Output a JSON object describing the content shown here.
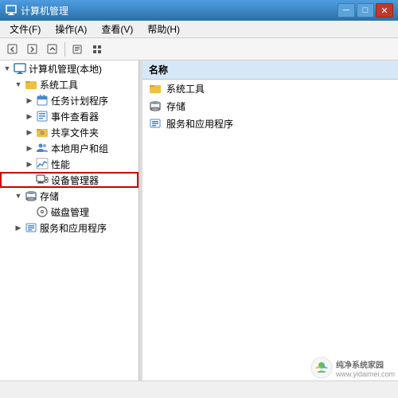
{
  "titleBar": {
    "title": "计算机管理",
    "minimizeLabel": "─",
    "maximizeLabel": "□",
    "closeLabel": "✕"
  },
  "menuBar": {
    "items": [
      {
        "id": "file",
        "label": "文件(F)"
      },
      {
        "id": "action",
        "label": "操作(A)"
      },
      {
        "id": "view",
        "label": "查看(V)"
      },
      {
        "id": "help",
        "label": "帮助(H)"
      }
    ]
  },
  "toolbar": {
    "buttons": [
      "←",
      "→",
      "↑",
      "✎",
      "☰"
    ]
  },
  "leftPanel": {
    "header": "计算机管理(本地)",
    "items": [
      {
        "id": "root",
        "label": "计算机管理(本地)",
        "level": 0,
        "expanded": true,
        "hasChildren": true,
        "icon": "computer"
      },
      {
        "id": "systools",
        "label": "系统工具",
        "level": 1,
        "expanded": true,
        "hasChildren": true,
        "icon": "folder"
      },
      {
        "id": "taskscheduler",
        "label": "任务计划程序",
        "level": 2,
        "expanded": false,
        "hasChildren": true,
        "icon": "calendar"
      },
      {
        "id": "eventviewer",
        "label": "事件查看器",
        "level": 2,
        "expanded": false,
        "hasChildren": true,
        "icon": "log"
      },
      {
        "id": "sharedfolders",
        "label": "共享文件夹",
        "level": 2,
        "expanded": false,
        "hasChildren": true,
        "icon": "folder"
      },
      {
        "id": "localusers",
        "label": "本地用户和组",
        "level": 2,
        "expanded": false,
        "hasChildren": true,
        "icon": "users"
      },
      {
        "id": "performance",
        "label": "性能",
        "level": 2,
        "expanded": false,
        "hasChildren": true,
        "icon": "chart"
      },
      {
        "id": "devicemanager",
        "label": "设备管理器",
        "level": 2,
        "expanded": false,
        "hasChildren": false,
        "icon": "device",
        "highlighted": true
      },
      {
        "id": "storage",
        "label": "存储",
        "level": 1,
        "expanded": true,
        "hasChildren": true,
        "icon": "storage"
      },
      {
        "id": "diskmgmt",
        "label": "磁盘管理",
        "level": 2,
        "expanded": false,
        "hasChildren": false,
        "icon": "disk"
      },
      {
        "id": "services",
        "label": "服务和应用程序",
        "level": 1,
        "expanded": false,
        "hasChildren": true,
        "icon": "services"
      }
    ]
  },
  "rightPanel": {
    "header": "名称",
    "items": [
      {
        "id": "systools",
        "label": "系统工具",
        "icon": "folder"
      },
      {
        "id": "storage",
        "label": "存储",
        "icon": "storage"
      },
      {
        "id": "services",
        "label": "服务和应用程序",
        "icon": "services"
      }
    ]
  },
  "statusBar": {
    "text": ""
  },
  "watermark": {
    "line1": "纯净系统家园",
    "line2": "www.yidaimei.com"
  }
}
